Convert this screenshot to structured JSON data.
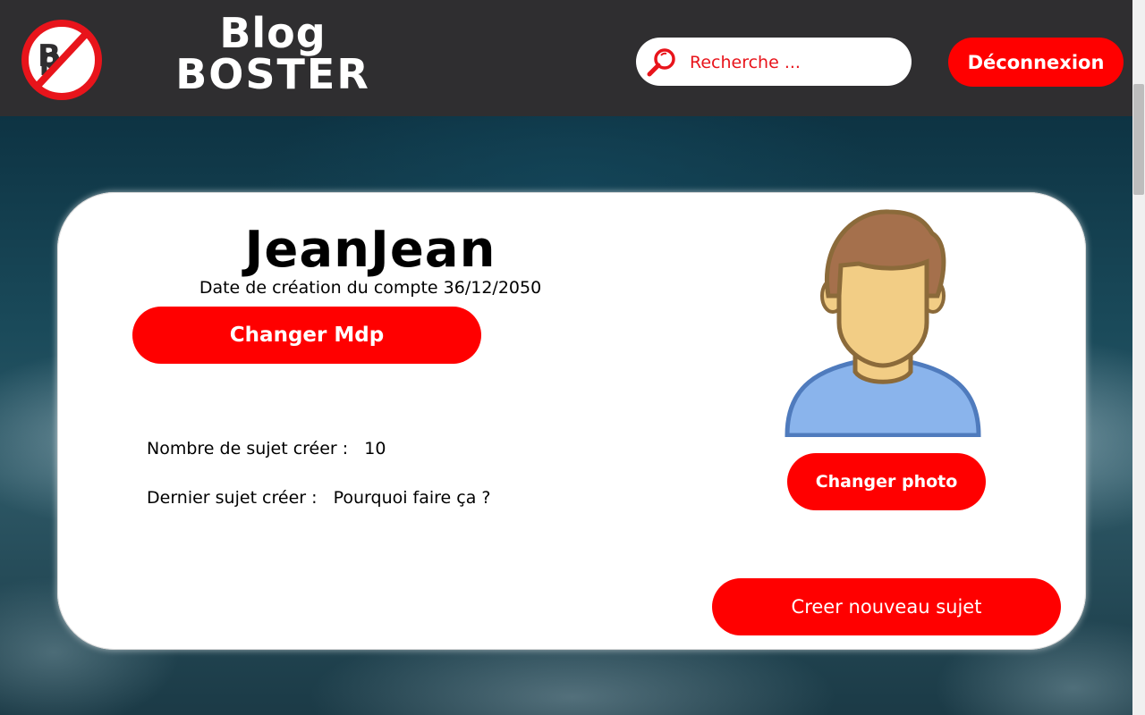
{
  "header": {
    "brand_line1": "Blog",
    "brand_line2": "BOSTER",
    "search_placeholder": "Recherche ...",
    "logout_label": "Déconnexion"
  },
  "profile": {
    "username": "JeanJean",
    "created_label": "Date de création du compte",
    "created_date": "36/12/2050",
    "change_password_label": "Changer Mdp",
    "topics_count_label": "Nombre de sujet créer :",
    "topics_count_value": "10",
    "last_topic_label": "Dernier sujet créer :",
    "last_topic_value": "Pourquoi faire ça ?",
    "change_photo_label": "Changer photo",
    "new_topic_label": "Creer nouveau sujet"
  },
  "icons": {
    "logo": "no-bd-logo-icon",
    "search": "magnifier-icon",
    "avatar": "user-avatar-icon"
  },
  "colors": {
    "accent": "#ff0000",
    "header_bg": "#2f2e30",
    "card_bg": "#ffffff"
  }
}
